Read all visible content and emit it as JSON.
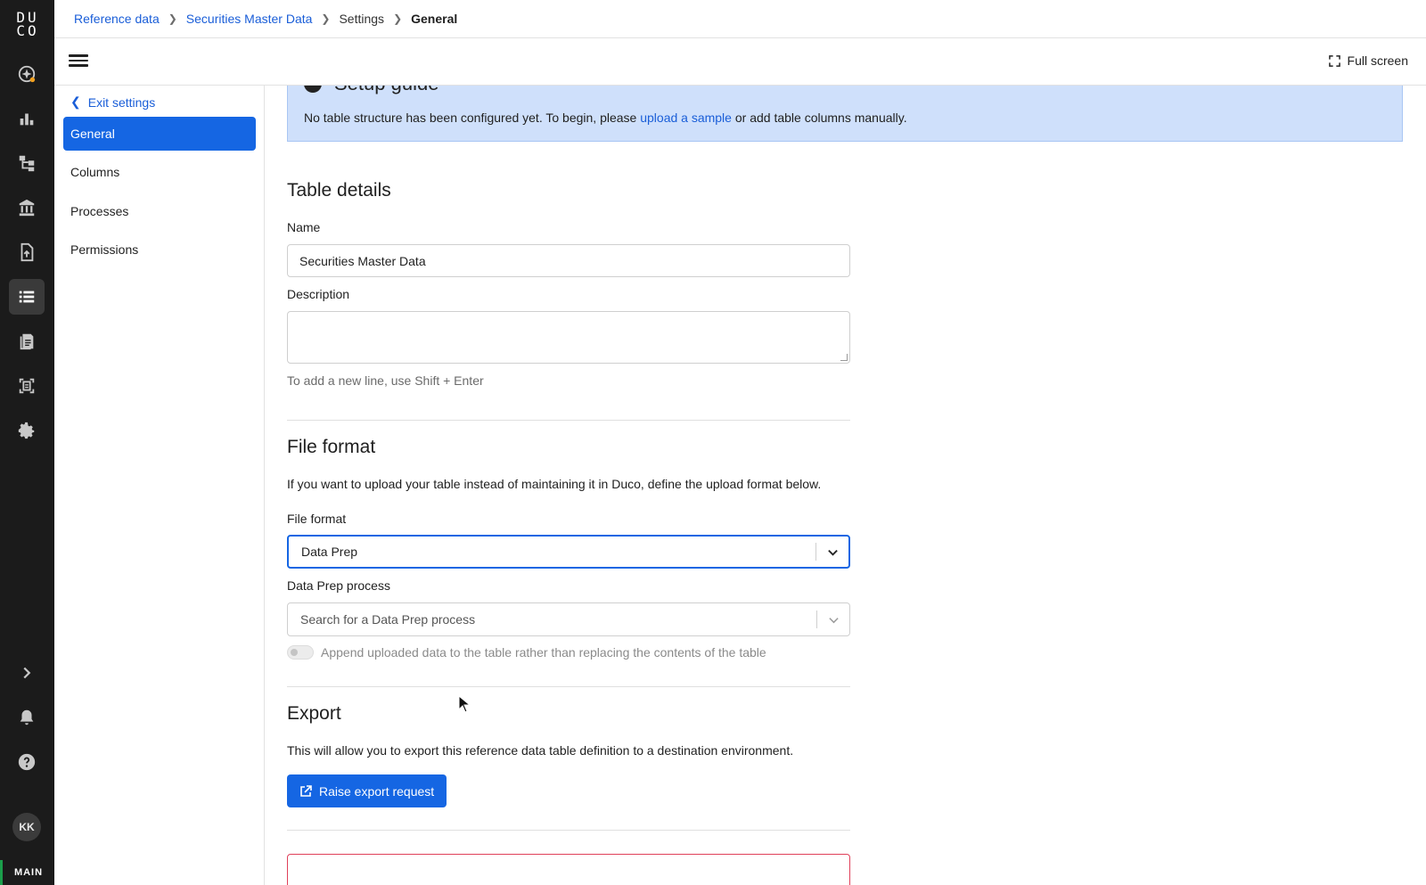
{
  "rail": {
    "logo": "DUCO",
    "icons": [
      "ai-assistant-icon",
      "dashboard-icon",
      "workflow-icon",
      "bank-icon",
      "upload-file-icon",
      "reference-data-icon",
      "reports-icon",
      "scan-icon",
      "settings-icon"
    ],
    "bottom_icons": [
      "expand-icon",
      "bell-icon",
      "help-icon"
    ],
    "avatar": "KK",
    "environment": "MAIN"
  },
  "breadcrumb": {
    "items": [
      "Reference data",
      "Securities Master Data",
      "Settings"
    ],
    "current": "General"
  },
  "toolbar": {
    "full_screen_label": "Full screen"
  },
  "settings_nav": {
    "exit_label": "Exit settings",
    "items": [
      {
        "label": "General",
        "selected": true
      },
      {
        "label": "Columns",
        "selected": false
      },
      {
        "label": "Processes",
        "selected": false
      },
      {
        "label": "Permissions",
        "selected": false
      }
    ]
  },
  "setup_guide": {
    "title": "Setup guide",
    "text_before": "No table structure has been configured yet. To begin, please ",
    "link": "upload a sample",
    "text_after": " or add table columns manually."
  },
  "table_details": {
    "title": "Table details",
    "name_label": "Name",
    "name_value": "Securities Master Data",
    "description_label": "Description",
    "description_value": "",
    "description_hint": "To add a new line, use Shift + Enter"
  },
  "file_format": {
    "title": "File format",
    "intro": "If you want to upload your table instead of maintaining it in Duco, define the upload format below.",
    "format_label": "File format",
    "format_value": "Data Prep",
    "process_label": "Data Prep process",
    "process_placeholder": "Search for a Data Prep process",
    "append_label": "Append uploaded data to the table rather than replacing the contents of the table",
    "append_enabled": false
  },
  "export": {
    "title": "Export",
    "intro": "This will allow you to export this reference data table definition to a destination environment.",
    "button_label": "Raise export request"
  },
  "colors": {
    "accent": "#1566e3",
    "link": "#1a5ed8",
    "rail_bg": "#1b1b1b",
    "guide_bg": "#cfe0fb",
    "danger": "#e0405a"
  }
}
